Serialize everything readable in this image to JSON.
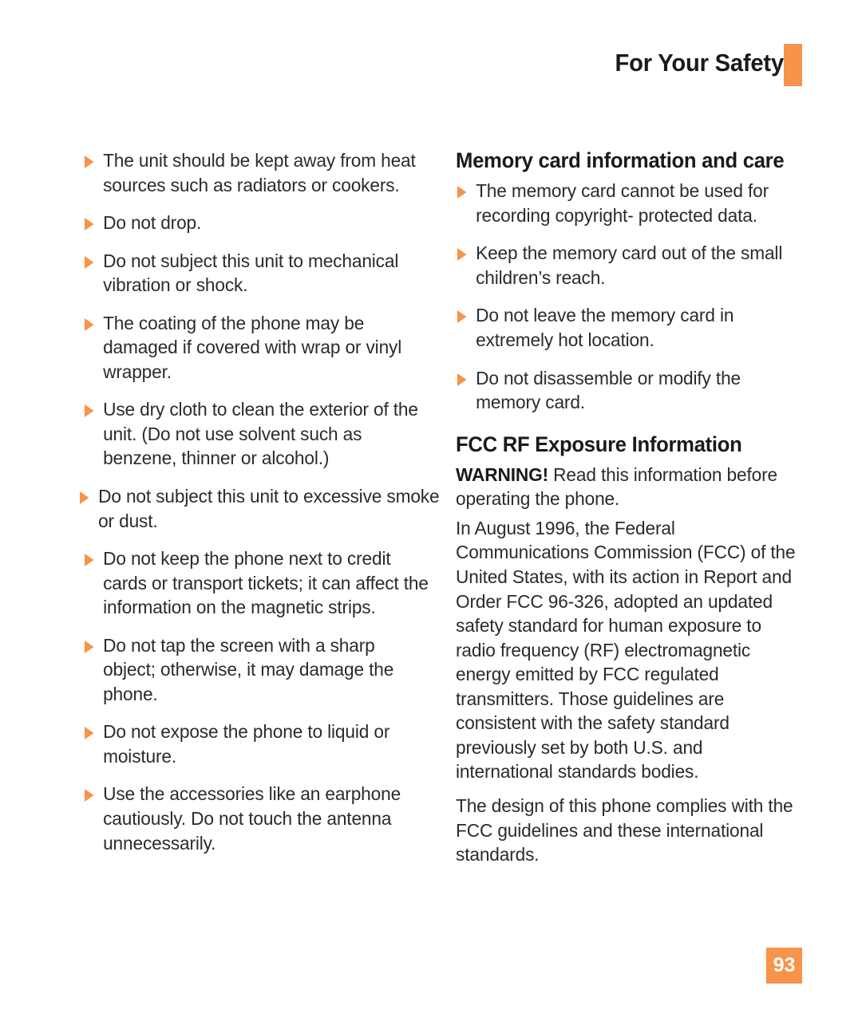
{
  "header": {
    "title": "For Your Safety",
    "accent_color": "#F7934A"
  },
  "left_column": {
    "bullets": [
      {
        "text": "The unit should be kept away from heat sources such as radiators or cookers."
      },
      {
        "text": "Do not drop."
      },
      {
        "text": "Do not subject this unit to mechanical vibration or shock."
      },
      {
        "text": "The coating of the phone may be damaged if covered with wrap or vinyl wrapper."
      },
      {
        "text": "Use dry cloth to clean the exterior of the unit. (Do not use solvent such as benzene, thinner or alcohol.)"
      },
      {
        "text": "Do not subject this unit to excessive smoke or dust."
      },
      {
        "text": "Do not keep the phone next to credit cards or transport tickets; it can affect the information on the magnetic strips."
      },
      {
        "text": "Do not tap the screen with a sharp object; otherwise, it may damage the phone."
      },
      {
        "text": "Do not expose the phone to liquid or moisture."
      },
      {
        "text": "Use the accessories like an earphone cautiously. Do not touch the antenna unnecessarily."
      }
    ]
  },
  "right_column": {
    "memory_section": {
      "heading": "Memory card information and care",
      "bullets": [
        {
          "text": "The memory card cannot be used for recording copyright- protected data."
        },
        {
          "text": "Keep the memory card out of the small children’s reach."
        },
        {
          "text": "Do not leave the memory card in extremely hot location."
        },
        {
          "text": "Do not disassemble or modify the memory card."
        }
      ]
    },
    "fcc_section": {
      "heading": "FCC RF Exposure Information",
      "warning_label": "WARNING!",
      "warning_text": " Read this information before operating the phone.",
      "paragraphs": [
        "In August 1996, the Federal Communications Commission (FCC) of the United States, with its action in Report and Order FCC 96-326, adopted an updated safety standard for human exposure to radio frequency (RF) electromagnetic energy emitted by FCC regulated transmitters. Those guidelines are consistent with the safety standard previously set by both U.S. and international standards bodies.",
        "The design of this phone complies with the FCC guidelines and these international standards."
      ]
    }
  },
  "footer": {
    "page_number": "93"
  }
}
